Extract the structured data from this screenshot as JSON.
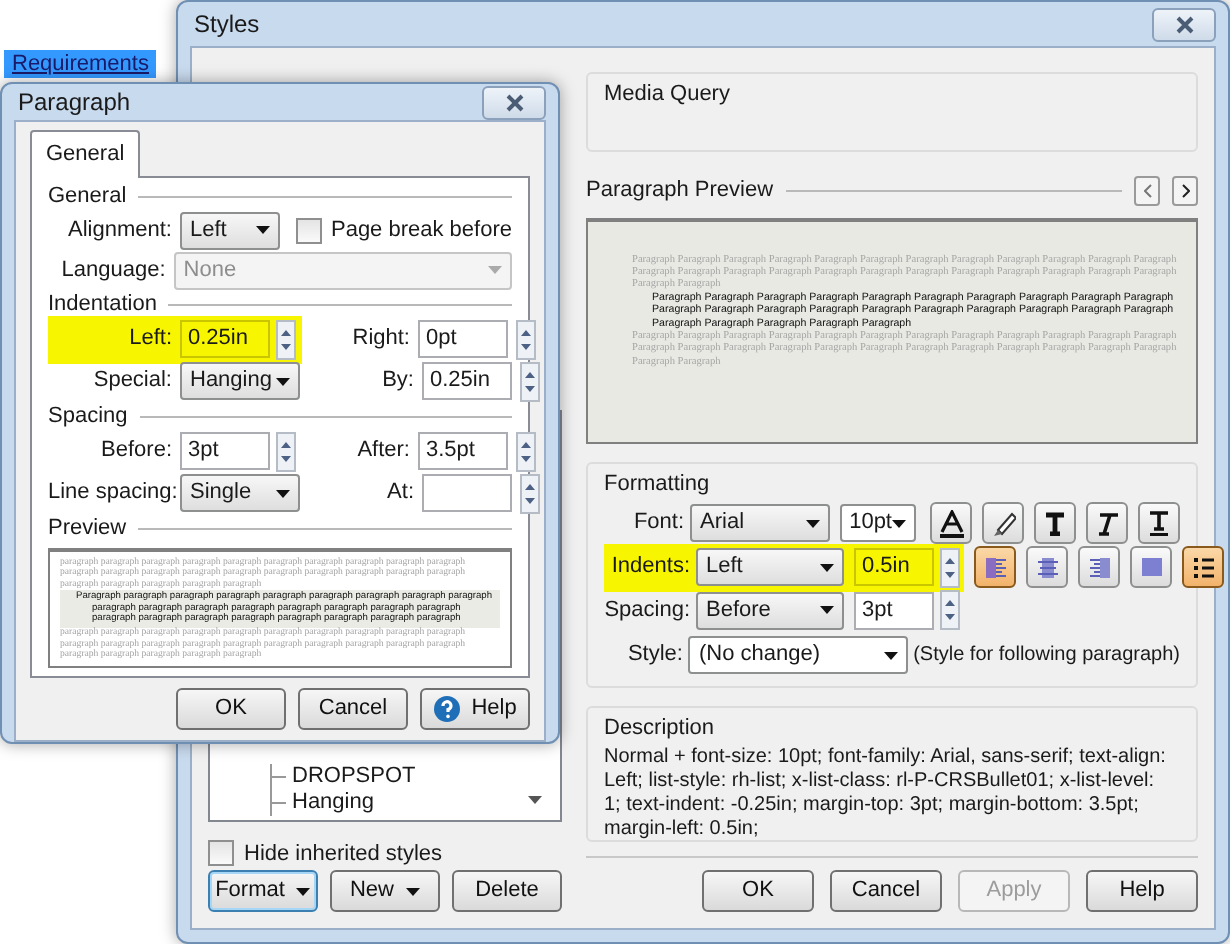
{
  "background": {
    "selected_item": "Requirements"
  },
  "styles_window": {
    "title": "Styles",
    "style_tree": [
      {
        "label": "DROPSPOT"
      },
      {
        "label": "Hanging"
      }
    ],
    "hide_inherited": {
      "label": "Hide inherited styles",
      "checked": false
    },
    "left_buttons": [
      {
        "label": "Format",
        "kind": "dropdown"
      },
      {
        "label": "New",
        "kind": "dropdown"
      },
      {
        "label": "Delete",
        "kind": "plain"
      }
    ],
    "media_query": {
      "title": "Media Query"
    },
    "paragraph_preview": {
      "title": "Paragraph Preview",
      "before": "Paragraph Paragraph Paragraph Paragraph Paragraph Paragraph Paragraph Paragraph Paragraph Paragraph Paragraph Paragraph Paragraph Paragraph Paragraph Paragraph Paragraph Paragraph Paragraph Paragraph Paragraph Paragraph Paragraph Paragraph Paragraph Paragraph",
      "sample": "Paragraph Paragraph Paragraph Paragraph Paragraph Paragraph Paragraph Paragraph Paragraph Paragraph Paragraph Paragraph Paragraph Paragraph Paragraph Paragraph Paragraph Paragraph Paragraph Paragraph Paragraph Paragraph Paragraph Paragraph Paragraph",
      "after": "Paragraph Paragraph Paragraph Paragraph Paragraph Paragraph Paragraph Paragraph Paragraph Paragraph Paragraph Paragraph Paragraph Paragraph Paragraph Paragraph Paragraph Paragraph Paragraph Paragraph Paragraph Paragraph Paragraph Paragraph Paragraph Paragraph"
    },
    "formatting": {
      "title": "Formatting",
      "font": {
        "label": "Font:",
        "value": "Arial",
        "size": "10pt"
      },
      "indents": {
        "label": "Indents:",
        "value": "Left",
        "amount": "0.5in",
        "highlighted": true
      },
      "spacing": {
        "label": "Spacing:",
        "value": "Before",
        "amount": "3pt"
      },
      "style": {
        "label": "Style:",
        "value": "(No change)",
        "note": "(Style for following paragraph)"
      },
      "tools": [
        {
          "kind": "font-color",
          "selected": false
        },
        {
          "kind": "highlight",
          "selected": false
        },
        {
          "kind": "bold",
          "selected": false
        },
        {
          "kind": "italic",
          "selected": false
        },
        {
          "kind": "underline",
          "selected": false
        },
        {
          "kind": "align-left",
          "selected": true
        },
        {
          "kind": "align-center",
          "selected": false
        },
        {
          "kind": "align-right",
          "selected": false
        },
        {
          "kind": "justify",
          "selected": false
        },
        {
          "kind": "list",
          "selected": true
        }
      ]
    },
    "description": {
      "title": "Description",
      "text": "Normal + font-size: 10pt; font-family: Arial, sans-serif; text-align: Left; list-style: rh-list; x-list-class: rl-P-CRSBullet01; x-list-level: 1; text-indent: -0.25in; margin-top: 3pt; margin-bottom: 3.5pt; margin-left: 0.5in;"
    },
    "buttons": [
      {
        "label": "OK",
        "disabled": false
      },
      {
        "label": "Cancel",
        "disabled": false
      },
      {
        "label": "Apply",
        "disabled": true
      },
      {
        "label": "Help",
        "disabled": false
      }
    ]
  },
  "paragraph_dialog": {
    "title": "Paragraph",
    "tabs": [
      {
        "label": "General",
        "selected": true
      }
    ],
    "general": {
      "title": "General",
      "alignment": {
        "label": "Alignment:",
        "value": "Left"
      },
      "page_break": {
        "label": "Page break before",
        "checked": false
      },
      "language": {
        "label": "Language:",
        "value": "None",
        "disabled": true
      }
    },
    "indentation": {
      "title": "Indentation",
      "left": {
        "label": "Left:",
        "value": "0.25in",
        "highlighted": true
      },
      "right": {
        "label": "Right:",
        "value": "0pt"
      },
      "special": {
        "label": "Special:",
        "value": "Hanging"
      },
      "by": {
        "label": "By:",
        "value": "0.25in"
      }
    },
    "spacing": {
      "title": "Spacing",
      "before": {
        "label": "Before:",
        "value": "3pt"
      },
      "after": {
        "label": "After:",
        "value": "3.5pt"
      },
      "line_spacing": {
        "label": "Line spacing:",
        "value": "Single"
      },
      "at": {
        "label": "At:"
      }
    },
    "preview": {
      "title": "Preview",
      "before": "paragraph paragraph paragraph paragraph paragraph paragraph paragraph paragraph paragraph paragraph paragraph paragraph paragraph paragraph paragraph paragraph paragraph paragraph paragraph paragraph paragraph paragraph paragraph paragraph paragraph",
      "sample": "Paragraph paragraph paragraph paragraph paragraph paragraph paragraph paragraph paragraph paragraph paragraph paragraph paragraph paragraph paragraph paragraph paragraph paragraph paragraph paragraph paragraph paragraph paragraph paragraph paragraph",
      "after": "paragraph paragraph paragraph paragraph paragraph paragraph paragraph paragraph paragraph paragraph paragraph paragraph paragraph paragraph paragraph paragraph paragraph paragraph paragraph paragraph paragraph paragraph paragraph paragraph paragraph"
    },
    "buttons": [
      {
        "label": "OK",
        "kind": "plain"
      },
      {
        "label": "Cancel",
        "kind": "plain"
      },
      {
        "label": "Help",
        "kind": "help"
      }
    ]
  }
}
